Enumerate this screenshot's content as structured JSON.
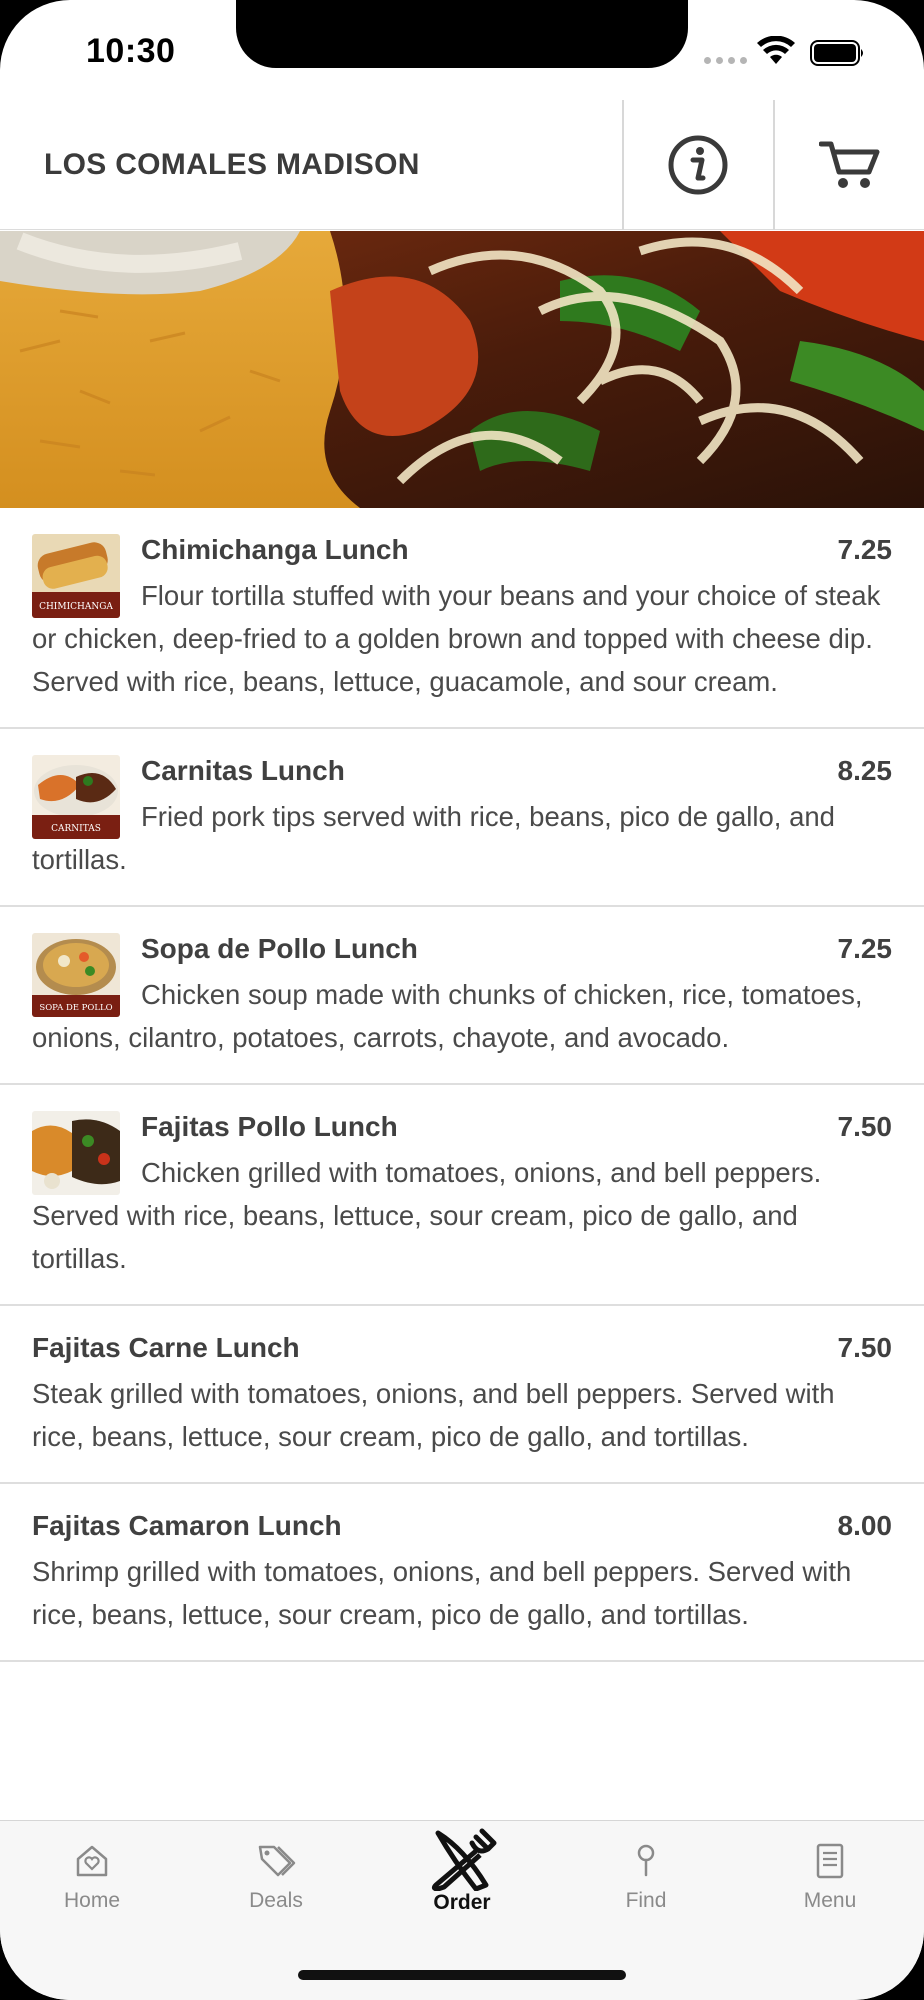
{
  "status": {
    "time": "10:30"
  },
  "header": {
    "title": "LOS COMALES MADISON",
    "info_icon": "info-icon",
    "cart_icon": "cart-icon"
  },
  "menu_items": [
    {
      "name": "Chimichanga Lunch",
      "price": "7.25",
      "thumb_label": "CHIMICHANGA",
      "description": "Flour tortilla stuffed with your beans and your choice of steak or chicken, deep-fried to a golden brown and topped with cheese dip. Served with rice, beans, lettuce, guacamole, and sour cream."
    },
    {
      "name": "Carnitas Lunch",
      "price": "8.25",
      "thumb_label": "CARNITAS",
      "description": "Fried pork tips served with rice, beans, pico de gallo, and tortillas."
    },
    {
      "name": "Sopa de Pollo Lunch",
      "price": "7.25",
      "thumb_label": "SOPA DE POLLO",
      "description": "Chicken soup made with chunks of chicken, rice, tomatoes, onions, cilantro, potatoes, carrots, chayote, and avocado."
    },
    {
      "name": "Fajitas Pollo Lunch",
      "price": "7.50",
      "description": "Chicken grilled with tomatoes, onions, and bell peppers. Served with rice, beans, lettuce, sour cream, pico de gallo, and tortillas."
    },
    {
      "name": "Fajitas Carne Lunch",
      "price": "7.50",
      "description": "Steak grilled with tomatoes, onions, and bell peppers. Served with rice, beans, lettuce, sour cream, pico de gallo, and tortillas."
    },
    {
      "name": "Fajitas Camaron Lunch",
      "price": "8.00",
      "description": "Shrimp grilled with tomatoes, onions, and bell peppers. Served with rice, beans, lettuce, sour cream, pico de gallo, and tortillas."
    }
  ],
  "tabs": [
    {
      "label": "Home",
      "icon": "home-icon"
    },
    {
      "label": "Deals",
      "icon": "tag-icon"
    },
    {
      "label": "Order",
      "icon": "fork-knife-icon",
      "active": true
    },
    {
      "label": "Find",
      "icon": "location-pin-icon"
    },
    {
      "label": "Menu",
      "icon": "book-icon"
    }
  ],
  "colors": {
    "text": "#404040",
    "divider": "#dedede",
    "tab_active": "#111111",
    "tab_inactive": "#8a8a8a"
  }
}
